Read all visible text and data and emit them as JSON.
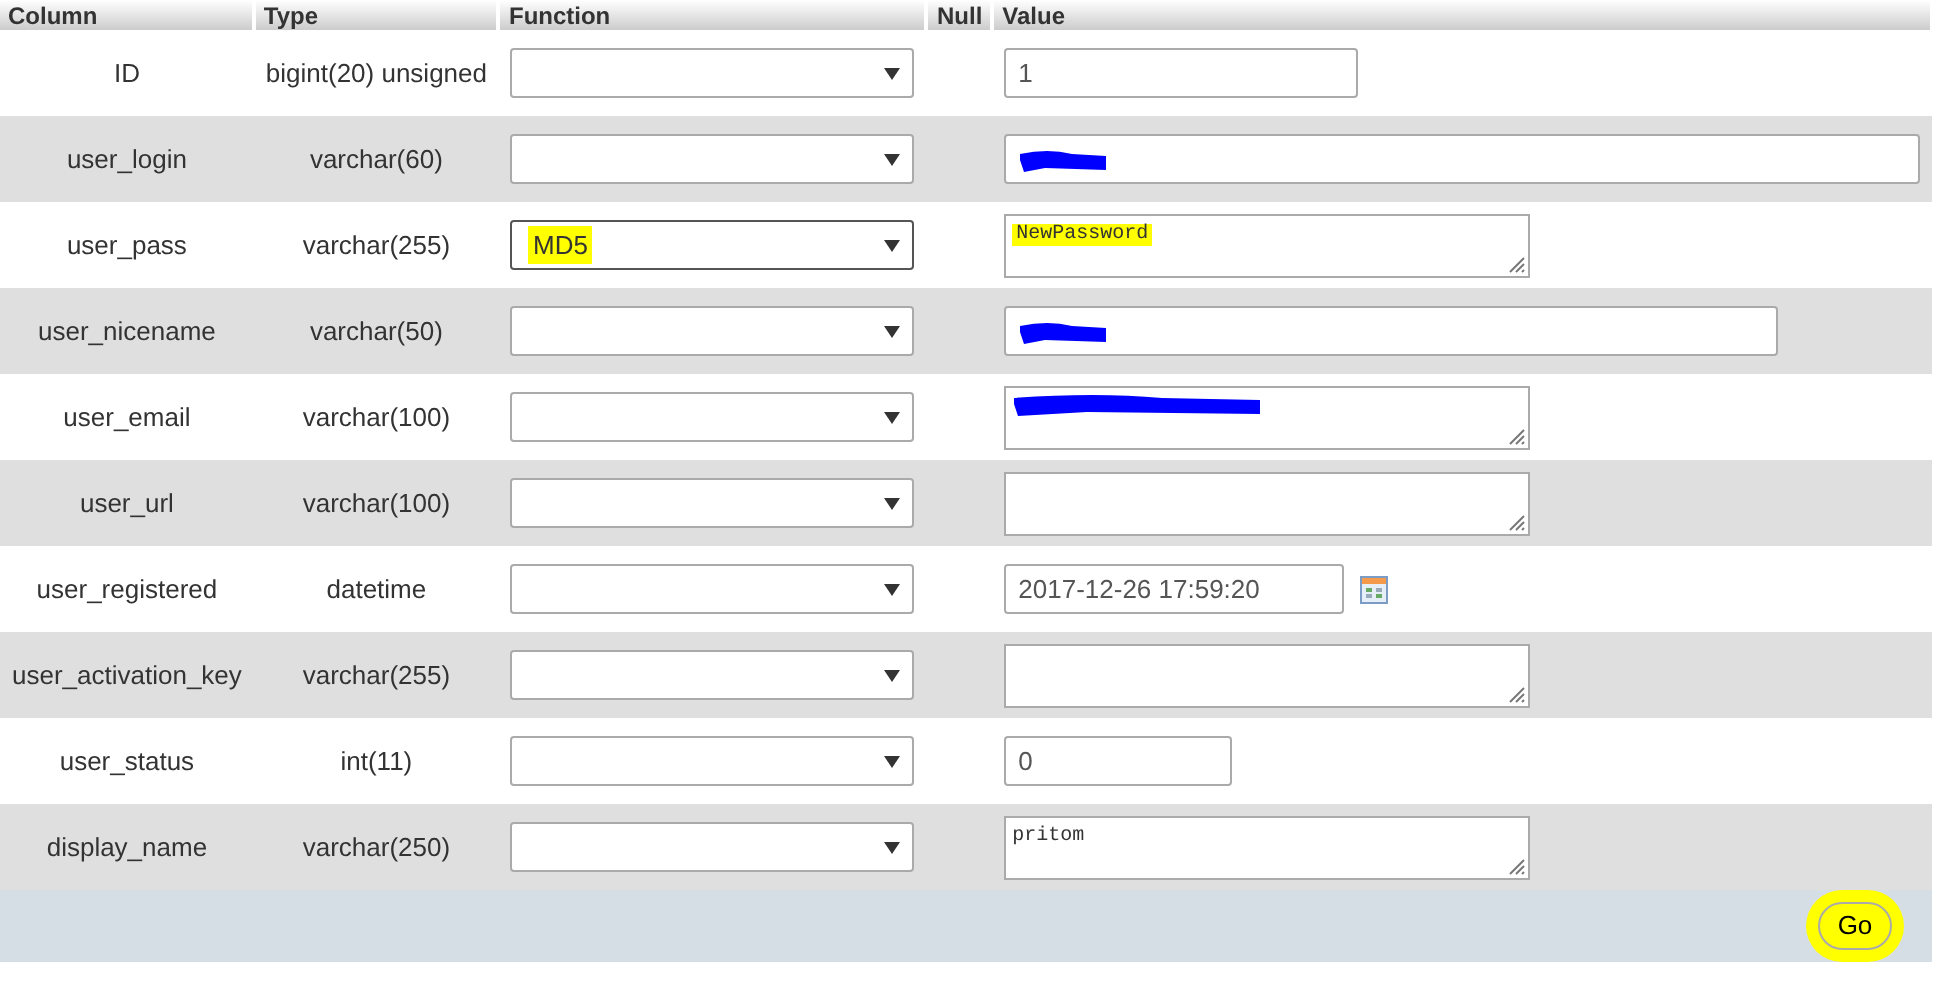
{
  "table": {
    "columns": [
      "Column",
      "Type",
      "Function",
      "Null",
      "Value"
    ],
    "rows": [
      {
        "column": "ID",
        "type": "bigint(20) unsigned",
        "function": {
          "highlighted": false
        },
        "value": {
          "kind": "input",
          "text": "1",
          "redacted": false,
          "highlighted": false
        }
      },
      {
        "column": "user_login",
        "type": "varchar(60)",
        "function": {
          "highlighted": false
        },
        "value": {
          "kind": "input",
          "redacted": true,
          "highlighted": false
        }
      },
      {
        "column": "user_pass",
        "type": "varchar(255)",
        "function": {
          "value": "MD5",
          "highlighted": true
        },
        "value": {
          "kind": "textarea",
          "text": "NewPassword",
          "redacted": false,
          "highlighted": true
        }
      },
      {
        "column": "user_nicename",
        "type": "varchar(50)",
        "function": {
          "highlighted": false
        },
        "value": {
          "kind": "input",
          "redacted": true,
          "highlighted": false
        }
      },
      {
        "column": "user_email",
        "type": "varchar(100)",
        "function": {
          "highlighted": false
        },
        "value": {
          "kind": "textarea",
          "redacted": true,
          "highlighted": false
        }
      },
      {
        "column": "user_url",
        "type": "varchar(100)",
        "function": {
          "highlighted": false
        },
        "value": {
          "kind": "textarea",
          "redacted": false,
          "highlighted": false
        }
      },
      {
        "column": "user_registered",
        "type": "datetime",
        "function": {
          "highlighted": false
        },
        "value": {
          "kind": "datetime",
          "text": "2017-12-26 17:59:20",
          "redacted": false,
          "highlighted": false
        }
      },
      {
        "column": "user_activation_key",
        "type": "varchar(255)",
        "function": {
          "highlighted": false
        },
        "value": {
          "kind": "textarea",
          "redacted": false,
          "highlighted": false
        }
      },
      {
        "column": "user_status",
        "type": "int(11)",
        "function": {
          "highlighted": false
        },
        "value": {
          "kind": "input",
          "text": "0",
          "redacted": false,
          "highlighted": false
        }
      },
      {
        "column": "display_name",
        "type": "varchar(250)",
        "function": {
          "highlighted": false
        },
        "value": {
          "kind": "textarea",
          "text": "pritom",
          "redacted": false,
          "highlighted": false
        }
      }
    ]
  },
  "go_button": {
    "label": "Go",
    "highlighted": true
  }
}
